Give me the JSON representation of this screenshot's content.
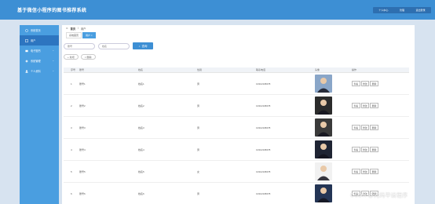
{
  "header": {
    "title": "基于微信小程序的图书推荐系统",
    "right": [
      "个人中心",
      "管理",
      "退出登录"
    ]
  },
  "sidebar": {
    "items": [
      {
        "label": "系统首页",
        "icon": "home-icon",
        "active": false,
        "has_arrow": false
      },
      {
        "label": "用户",
        "icon": "user-icon",
        "active": true,
        "has_arrow": false
      },
      {
        "label": "电子图书",
        "icon": "book-icon",
        "active": false,
        "has_arrow": true
      },
      {
        "label": "系统管理",
        "icon": "gear-icon",
        "active": false,
        "has_arrow": true
      },
      {
        "label": "个人资料",
        "icon": "profile-icon",
        "active": false,
        "has_arrow": true
      }
    ]
  },
  "breadcrumb": {
    "home": "首页",
    "sep": "/",
    "current": "用户"
  },
  "tabs": [
    {
      "label": "系统首页"
    },
    {
      "label": "用户 ×"
    }
  ],
  "search": {
    "field1_placeholder": "账号",
    "field2_placeholder": "姓名",
    "button_label": "查询"
  },
  "actions": {
    "add_label": "新增",
    "delete_label": "删除"
  },
  "table": {
    "headers": [
      "",
      "序号",
      "账号",
      "姓名",
      "性别",
      "联系电话",
      "头像",
      "操作"
    ],
    "rows": [
      {
        "idx": "1",
        "account": "账号1",
        "name": "姓名1",
        "gender": "男",
        "phone": "13312345678",
        "photo": "#8aa6c8"
      },
      {
        "idx": "2",
        "account": "账号2",
        "name": "姓名2",
        "gender": "男",
        "phone": "13312345678",
        "photo": "#2b2b2b"
      },
      {
        "idx": "3",
        "account": "账号3",
        "name": "姓名3",
        "gender": "男",
        "phone": "13312345678",
        "photo": "#3a3a3a"
      },
      {
        "idx": "4",
        "account": "账号4",
        "name": "姓名4",
        "gender": "男",
        "phone": "13312345678",
        "photo": "#1f2433"
      },
      {
        "idx": "5",
        "account": "账号5",
        "name": "姓名5",
        "gender": "女",
        "phone": "13312345678",
        "photo": "#f1f1f1"
      },
      {
        "idx": "6",
        "account": "账号6",
        "name": "姓名6",
        "gender": "男",
        "phone": "13312345678",
        "photo": "#243555"
      }
    ],
    "ops": [
      "查看",
      "修改",
      "删除"
    ]
  },
  "watermark": "CSDN @光码毕设程序"
}
